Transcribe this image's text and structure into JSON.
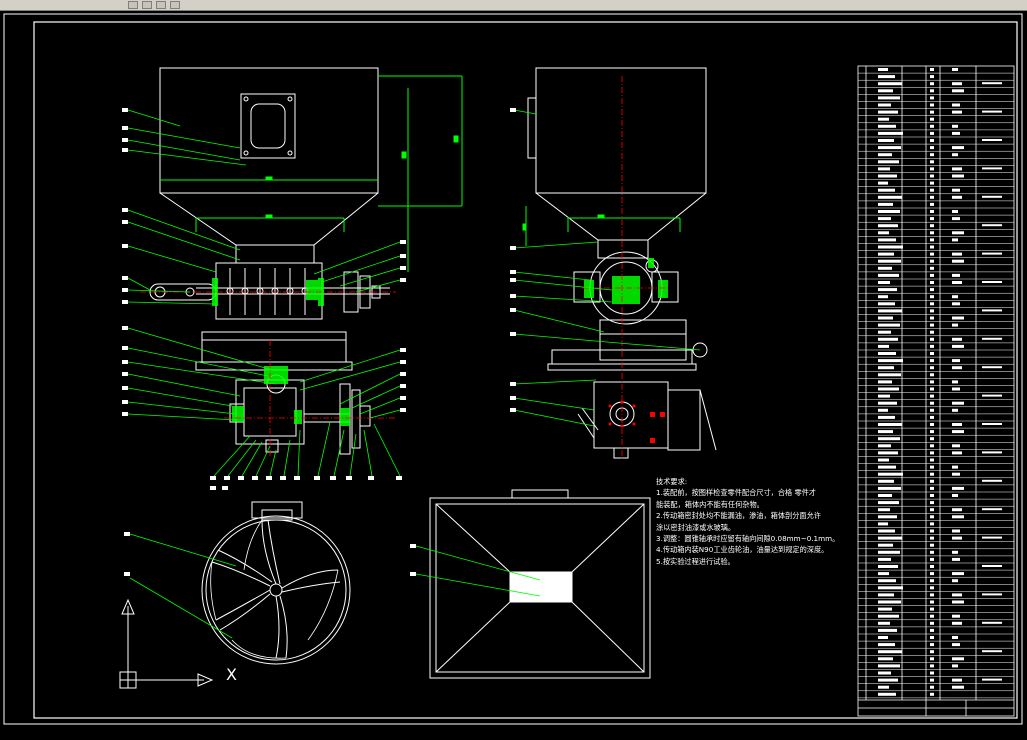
{
  "window": {
    "title": "",
    "controls": [
      "minimize",
      "maximize",
      "close"
    ]
  },
  "ucs": {
    "x_label": "X",
    "y_label": "Y"
  },
  "technical_notes": {
    "heading": "技术要求:",
    "lines": [
      "1.装配前，按图样检查零件配合尺寸，合格   零件才",
      "能装配，箱体内不能有任何杂物。",
      "2.传动箱密封处均不能漏油，渗油，箱体剖分面允许",
      "涂以密封油漆或水玻璃。",
      "3.调整：圆锥轴承时应留有轴向间隙0.08mm~0.1mm。",
      "4.传动箱内装N90工业齿轮油，油量达到规定的深度。",
      "5.按实验过程进行试验。"
    ]
  },
  "colors": {
    "background": "#000000",
    "lines": "#ffffff",
    "dimension": "#00ff00",
    "centerline": "#ff0000",
    "hatch": "#00ff00"
  }
}
